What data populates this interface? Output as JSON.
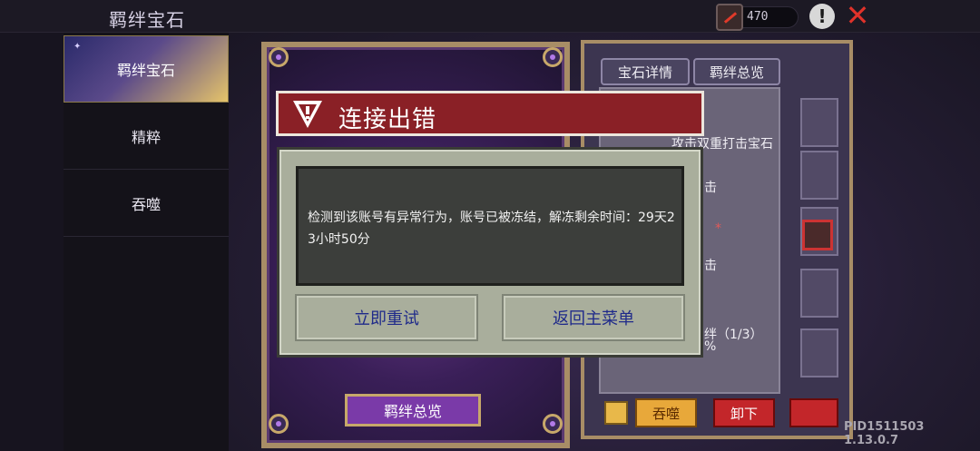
{
  "header": {
    "title": "羁绊宝石",
    "currency_value": "470",
    "icons": {
      "currency": "red-sword-icon",
      "help": "exclamation-icon",
      "close": "close-icon"
    }
  },
  "sidebar": {
    "items": [
      {
        "label": "羁绊宝石",
        "active": true
      },
      {
        "label": "精粹",
        "active": false
      },
      {
        "label": "吞噬",
        "active": false
      }
    ]
  },
  "card": {
    "overview_button": "羁绊总览"
  },
  "right_panel": {
    "tabs": [
      "宝石详情",
      "羁绊总览"
    ],
    "gem_description": "攻击双重打击宝石",
    "fragments": {
      "a": "击",
      "b": "*",
      "c": "击",
      "d": "绊（1/3）",
      "e": "%"
    },
    "buttons": {
      "devour": "吞噬",
      "unload": "卸下"
    }
  },
  "dialog": {
    "title": "连接出错",
    "message": "检测到该账号有异常行为，账号已被冻结，解冻剩余时间：29天23小时50分",
    "retry_button": "立即重试",
    "main_menu_button": "返回主菜单"
  },
  "footer": {
    "version": "PID1511503 1.13.0.7"
  },
  "colors": {
    "dialog_header": "#8a2026",
    "dialog_body": "#a9ae9c",
    "button_text": "#1f2a8a",
    "accent_gold": "#a88d66"
  }
}
